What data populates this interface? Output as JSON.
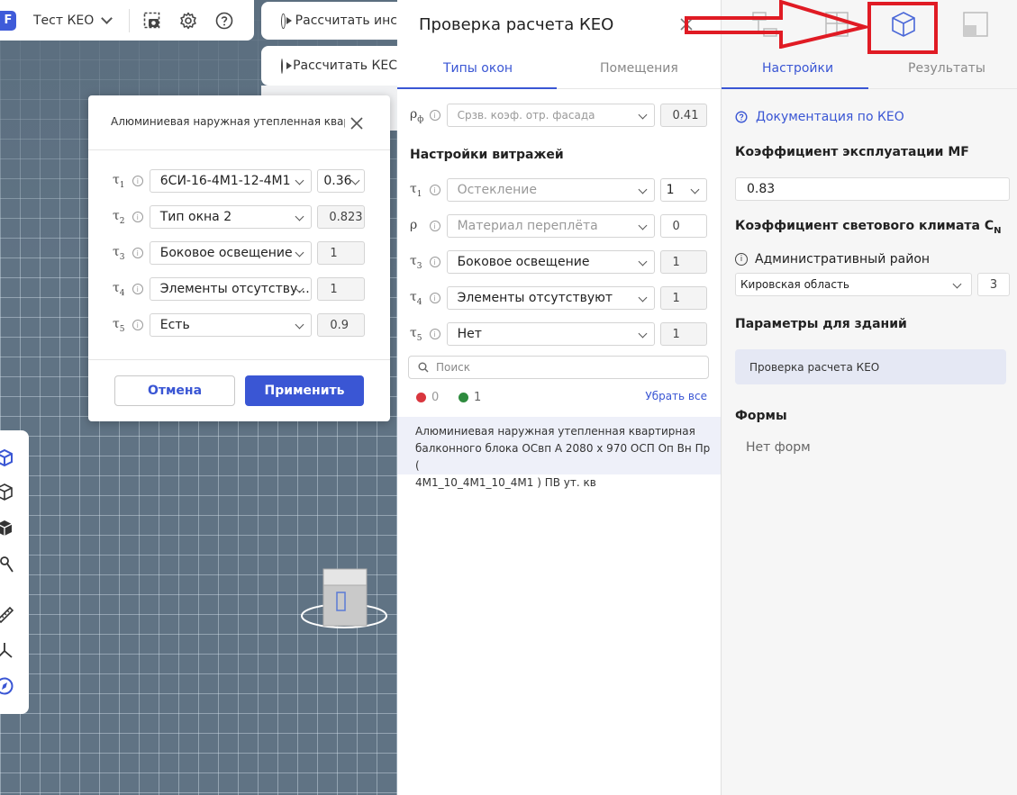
{
  "topbar": {
    "logo_letter": "F",
    "project_name": "Тест КЕО"
  },
  "calc_buttons": [
    "Рассчитать инс",
    "Рассчитать КЕС"
  ],
  "dialog": {
    "title": "Алюминиевая наружная утепленная квар...",
    "rows": [
      {
        "symbol": "τ",
        "index": "1",
        "select": "6СИ-16-4М1-12-4М1",
        "value": "0.36"
      },
      {
        "symbol": "τ",
        "index": "2",
        "select": "Тип окна 2",
        "value": "0.823"
      },
      {
        "symbol": "τ",
        "index": "3",
        "select": "Боковое освещение",
        "value": "1"
      },
      {
        "symbol": "τ",
        "index": "4",
        "select": "Элементы отсутству...",
        "value": "1"
      },
      {
        "symbol": "τ",
        "index": "5",
        "select": "Есть",
        "value": "0.9"
      }
    ],
    "cancel_label": "Отмена",
    "apply_label": "Применить"
  },
  "middle": {
    "title": "Проверка расчета КЕО",
    "tabs": [
      "Типы окон",
      "Помещения"
    ],
    "facade_row": {
      "symbol": "ρ",
      "index": "ф",
      "placeholder": "Срзв. коэф. отр. фасада",
      "value": "0.41"
    },
    "stained_glass_title": "Настройки витражей",
    "rows": [
      {
        "symbol": "τ",
        "index": "1",
        "select": "Остекление",
        "placeholder": true,
        "value": "1"
      },
      {
        "symbol": "ρ",
        "index": "",
        "select": "Материал переплёта",
        "placeholder": true,
        "value": "0"
      },
      {
        "symbol": "τ",
        "index": "3",
        "select": "Боковое освещение",
        "placeholder": false,
        "value": "1"
      },
      {
        "symbol": "τ",
        "index": "4",
        "select": "Элементы отсутствуют",
        "placeholder": false,
        "value": "1"
      },
      {
        "symbol": "τ",
        "index": "5",
        "select": "Нет",
        "placeholder": false,
        "value": "1"
      }
    ],
    "search_placeholder": "Поиск",
    "errors_count": "0",
    "ok_count": "1",
    "clear_all": "Убрать все",
    "list_item_lines": [
      "Алюминиевая наружная утепленная квартирная",
      "балконного блока ОСвп А 2080 х 970 ОСП Оп Вн Пр (",
      "4М1_10_4М1_10_4М1 ) ПВ ут. кв"
    ]
  },
  "right": {
    "tabs": [
      "Настройки",
      "Результаты"
    ],
    "doc_link": "Документация по КЕО",
    "mf_title": "Коэффициент эксплуатации MF",
    "mf_value": "0.83",
    "climate_title": "Коэффициент светового климата C",
    "climate_sub": "N",
    "district_label": "Административный район",
    "district_value": "Кировская область",
    "district_coef": "3",
    "buildings_title": "Параметры для зданий",
    "building_card": "Проверка расчета КЕО",
    "forms_title": "Формы",
    "forms_empty": "Нет форм"
  },
  "colors": {
    "accent": "#3a56d4",
    "highlight": "#e01b24",
    "viewport_bg": "#607384"
  }
}
